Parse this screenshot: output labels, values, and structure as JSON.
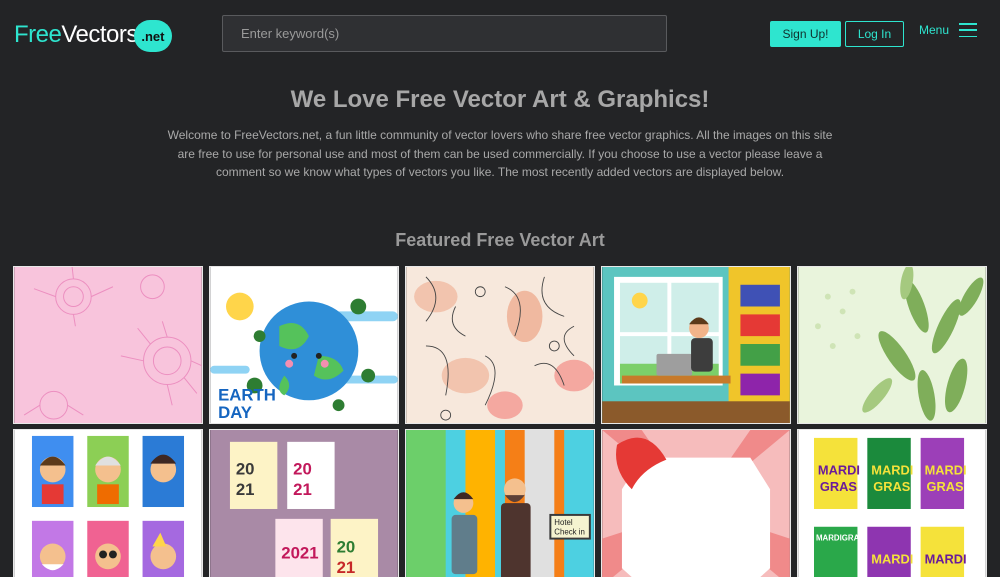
{
  "header": {
    "logo_part1": "Free",
    "logo_part2": "Vectors",
    "logo_badge": ".net",
    "search_placeholder": "Enter keyword(s)",
    "signup_label": "Sign Up!",
    "login_label": "Log In",
    "menu_label": "Menu"
  },
  "hero": {
    "title": "We Love Free Vector Art & Graphics!",
    "text": "Welcome to FreeVectors.net, a fun little community of vector lovers who share free vector graphics. All the images on this site are free to use for personal use and most of them can be used commercially. If you choose to use a vector please leave a comment so we know what types of vectors you like. The most recently added vectors are displayed below."
  },
  "featured": {
    "title": "Featured Free Vector Art",
    "tiles": [
      {
        "name": "pink-chrysanthemum-background",
        "text": ""
      },
      {
        "name": "earth-day-illustration",
        "text": "EARTH DAY"
      },
      {
        "name": "line-art-faces-pattern",
        "text": ""
      },
      {
        "name": "man-working-at-laptop",
        "text": ""
      },
      {
        "name": "green-plant-background",
        "text": ""
      },
      {
        "name": "video-call-avatars",
        "text": ""
      },
      {
        "name": "2021-new-year-cards",
        "text": "2021"
      },
      {
        "name": "hotel-check-in-illustration",
        "text": "Hotel Check in"
      },
      {
        "name": "red-bow-gift-frame",
        "text": ""
      },
      {
        "name": "mardi-gras-posters",
        "text": "MARDI GRAS"
      }
    ]
  },
  "colors": {
    "accent": "#2ee5cf",
    "background": "#232426"
  }
}
